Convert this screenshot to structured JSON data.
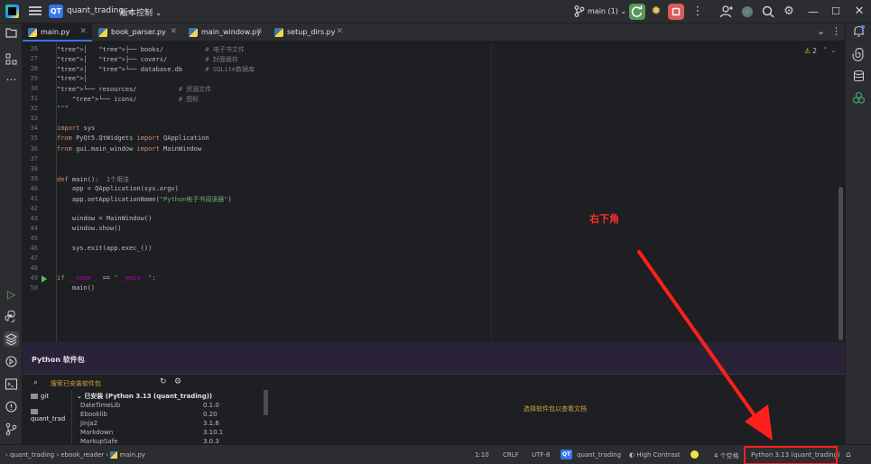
{
  "titlebar": {
    "project_badge": "QT",
    "project_name": "quant_trading",
    "vcs_label": "版本控制",
    "branch": "main (1)"
  },
  "tabs": [
    {
      "label": "main.py",
      "active": true
    },
    {
      "label": "book_parser.py",
      "active": false
    },
    {
      "label": "main_window.py",
      "active": false
    },
    {
      "label": "setup_dirs.py",
      "active": false
    }
  ],
  "editor": {
    "inspection_count": "2",
    "lines": [
      {
        "n": "26",
        "text": "│   ├── books/           # 电子书文件"
      },
      {
        "n": "27",
        "text": "│   ├── covers/          # 封面缓存"
      },
      {
        "n": "28",
        "text": "│   └── database.db      # SQLite数据库"
      },
      {
        "n": "29",
        "text": "│"
      },
      {
        "n": "30",
        "text": "└── resources/           # 资源文件"
      },
      {
        "n": "31",
        "text": "    └── icons/           # 图标"
      },
      {
        "n": "32",
        "text": "\"\"\""
      },
      {
        "n": "33",
        "text": ""
      },
      {
        "n": "34",
        "text": "import sys"
      },
      {
        "n": "35",
        "text": "from PyQt5.QtWidgets import QApplication"
      },
      {
        "n": "36",
        "text": "from gui.main_window import MainWindow"
      },
      {
        "n": "37",
        "text": ""
      },
      {
        "n": "38",
        "text": ""
      },
      {
        "n": "39",
        "text": "def main():  1个用法"
      },
      {
        "n": "40",
        "text": "    app = QApplication(sys.argv)"
      },
      {
        "n": "41",
        "text": "    app.setApplicationName(\"Python电子书阅读器\")"
      },
      {
        "n": "42",
        "text": ""
      },
      {
        "n": "43",
        "text": "    window = MainWindow()"
      },
      {
        "n": "44",
        "text": "    window.show()"
      },
      {
        "n": "45",
        "text": ""
      },
      {
        "n": "46",
        "text": "    sys.exit(app.exec_())"
      },
      {
        "n": "47",
        "text": ""
      },
      {
        "n": "48",
        "text": ""
      },
      {
        "n": "49",
        "text": "if __name__ == \"__main__\":"
      },
      {
        "n": "50",
        "text": "    main()"
      }
    ]
  },
  "annotation": {
    "text": "右下角"
  },
  "packages": {
    "title": "Python 软件包",
    "search_placeholder": "搜索已安装软件包",
    "repos": [
      "git",
      "quant_trad"
    ],
    "tree_header": "已安装 (Python 3.13 (quant_trading))",
    "rows": [
      {
        "name": "DateTimeLib",
        "version": "0.1.0"
      },
      {
        "name": "Ebooklib",
        "version": "0.20"
      },
      {
        "name": "Jinja2",
        "version": "3.1.6"
      },
      {
        "name": "Markdown",
        "version": "3.10.1"
      },
      {
        "name": "MarkupSafe",
        "version": "3.0.3"
      }
    ],
    "empty_message": "选择软件包以查看文档"
  },
  "statusbar": {
    "breadcrumb": [
      "quant_trading",
      "ebook_reader",
      "main.py"
    ],
    "position": "1:10",
    "line_sep": "CRLF",
    "encoding": "UTF-8",
    "project_badge": "QT",
    "project_name": "quant_trading",
    "theme": "High Contrast",
    "spaces": "4 个空格",
    "interpreter": "Python 3.13 (quant_trading)"
  },
  "colors": {
    "accent": "#3574f0",
    "annotation": "#ff1f1f"
  }
}
